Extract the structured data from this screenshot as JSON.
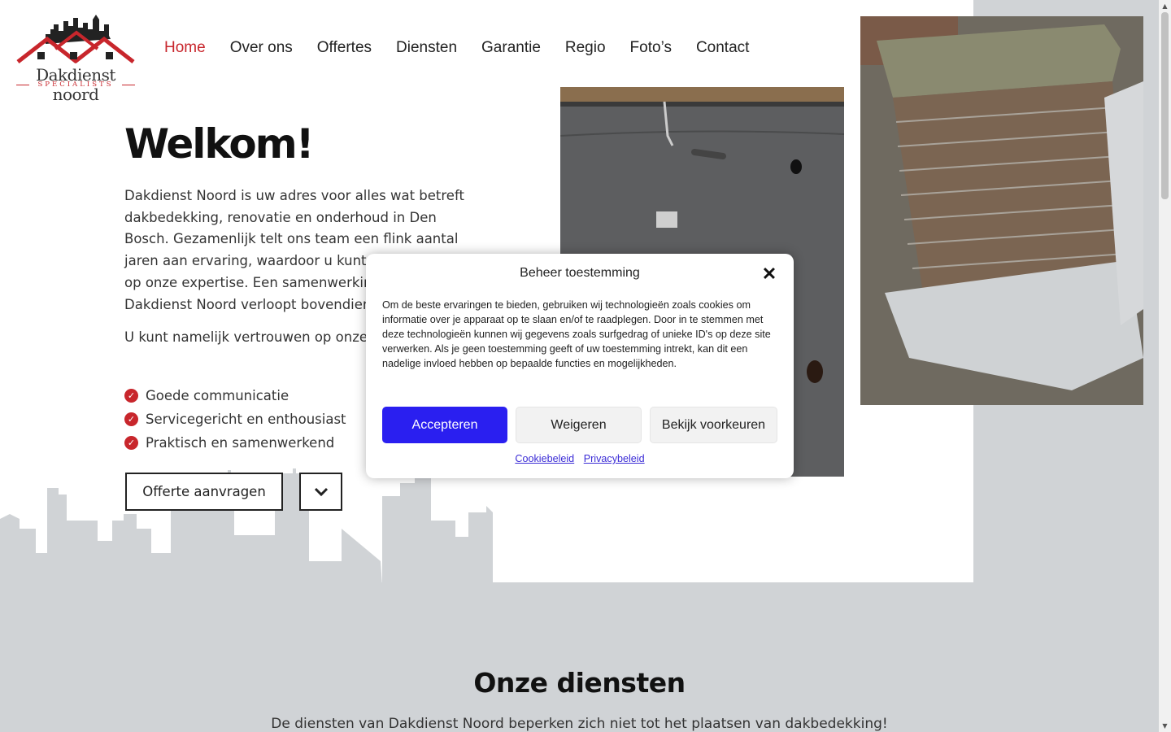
{
  "brand": {
    "name": "Dakdienst noord",
    "tagline": "SPECIALISTS",
    "accent_color": "#c8262c"
  },
  "nav": {
    "items": [
      {
        "label": "Home",
        "active": true
      },
      {
        "label": "Over ons",
        "active": false
      },
      {
        "label": "Offertes",
        "active": false
      },
      {
        "label": "Diensten",
        "active": false
      },
      {
        "label": "Garantie",
        "active": false
      },
      {
        "label": "Regio",
        "active": false
      },
      {
        "label": "Foto’s",
        "active": false
      },
      {
        "label": "Contact",
        "active": false
      }
    ]
  },
  "hero": {
    "title": "Welkom!",
    "paragraph1": "Dakdienst Noord is uw adres voor alles wat betreft dakbedekking, renovatie en onderhoud in Den Bosch. Gezamenlijk telt ons team een flink aantal jaren aan ervaring, waardoor u kunt vertrouwen op onze expertise. Een samenwerking met Dakdienst Noord verloopt bovendien altijd soepel!",
    "paragraph2": "U kunt namelijk vertrouwen op onze drie pijlers:",
    "list": [
      "Goede communicatie",
      "Servicegericht en enthousiast",
      "Praktisch en samenwerkend"
    ],
    "cta_label": "Offerte aanvragen"
  },
  "services": {
    "title": "Onze diensten",
    "subtitle": "De diensten van Dakdienst Noord beperken zich niet tot het plaatsen van dakbedekking!"
  },
  "cookie_modal": {
    "title": "Beheer toestemming",
    "body": "Om de beste ervaringen te bieden, gebruiken wij technologieën zoals cookies om informatie over je apparaat op te slaan en/of te raadplegen. Door in te stemmen met deze technologieën kunnen wij gegevens zoals surfgedrag of unieke ID's op deze site verwerken. Als je geen toestemming geeft of uw toestemming intrekt, kan dit een nadelige invloed hebben op bepaalde functies en mogelijkheden.",
    "accept_label": "Accepteren",
    "deny_label": "Weigeren",
    "prefs_label": "Bekijk voorkeuren",
    "link_cookie": "Cookiebeleid",
    "link_privacy": "Privacybeleid",
    "accept_color": "#2a1ff0"
  },
  "icons": {
    "check": "check-circle-icon",
    "chevron": "chevron-down-icon",
    "close": "close-icon"
  }
}
